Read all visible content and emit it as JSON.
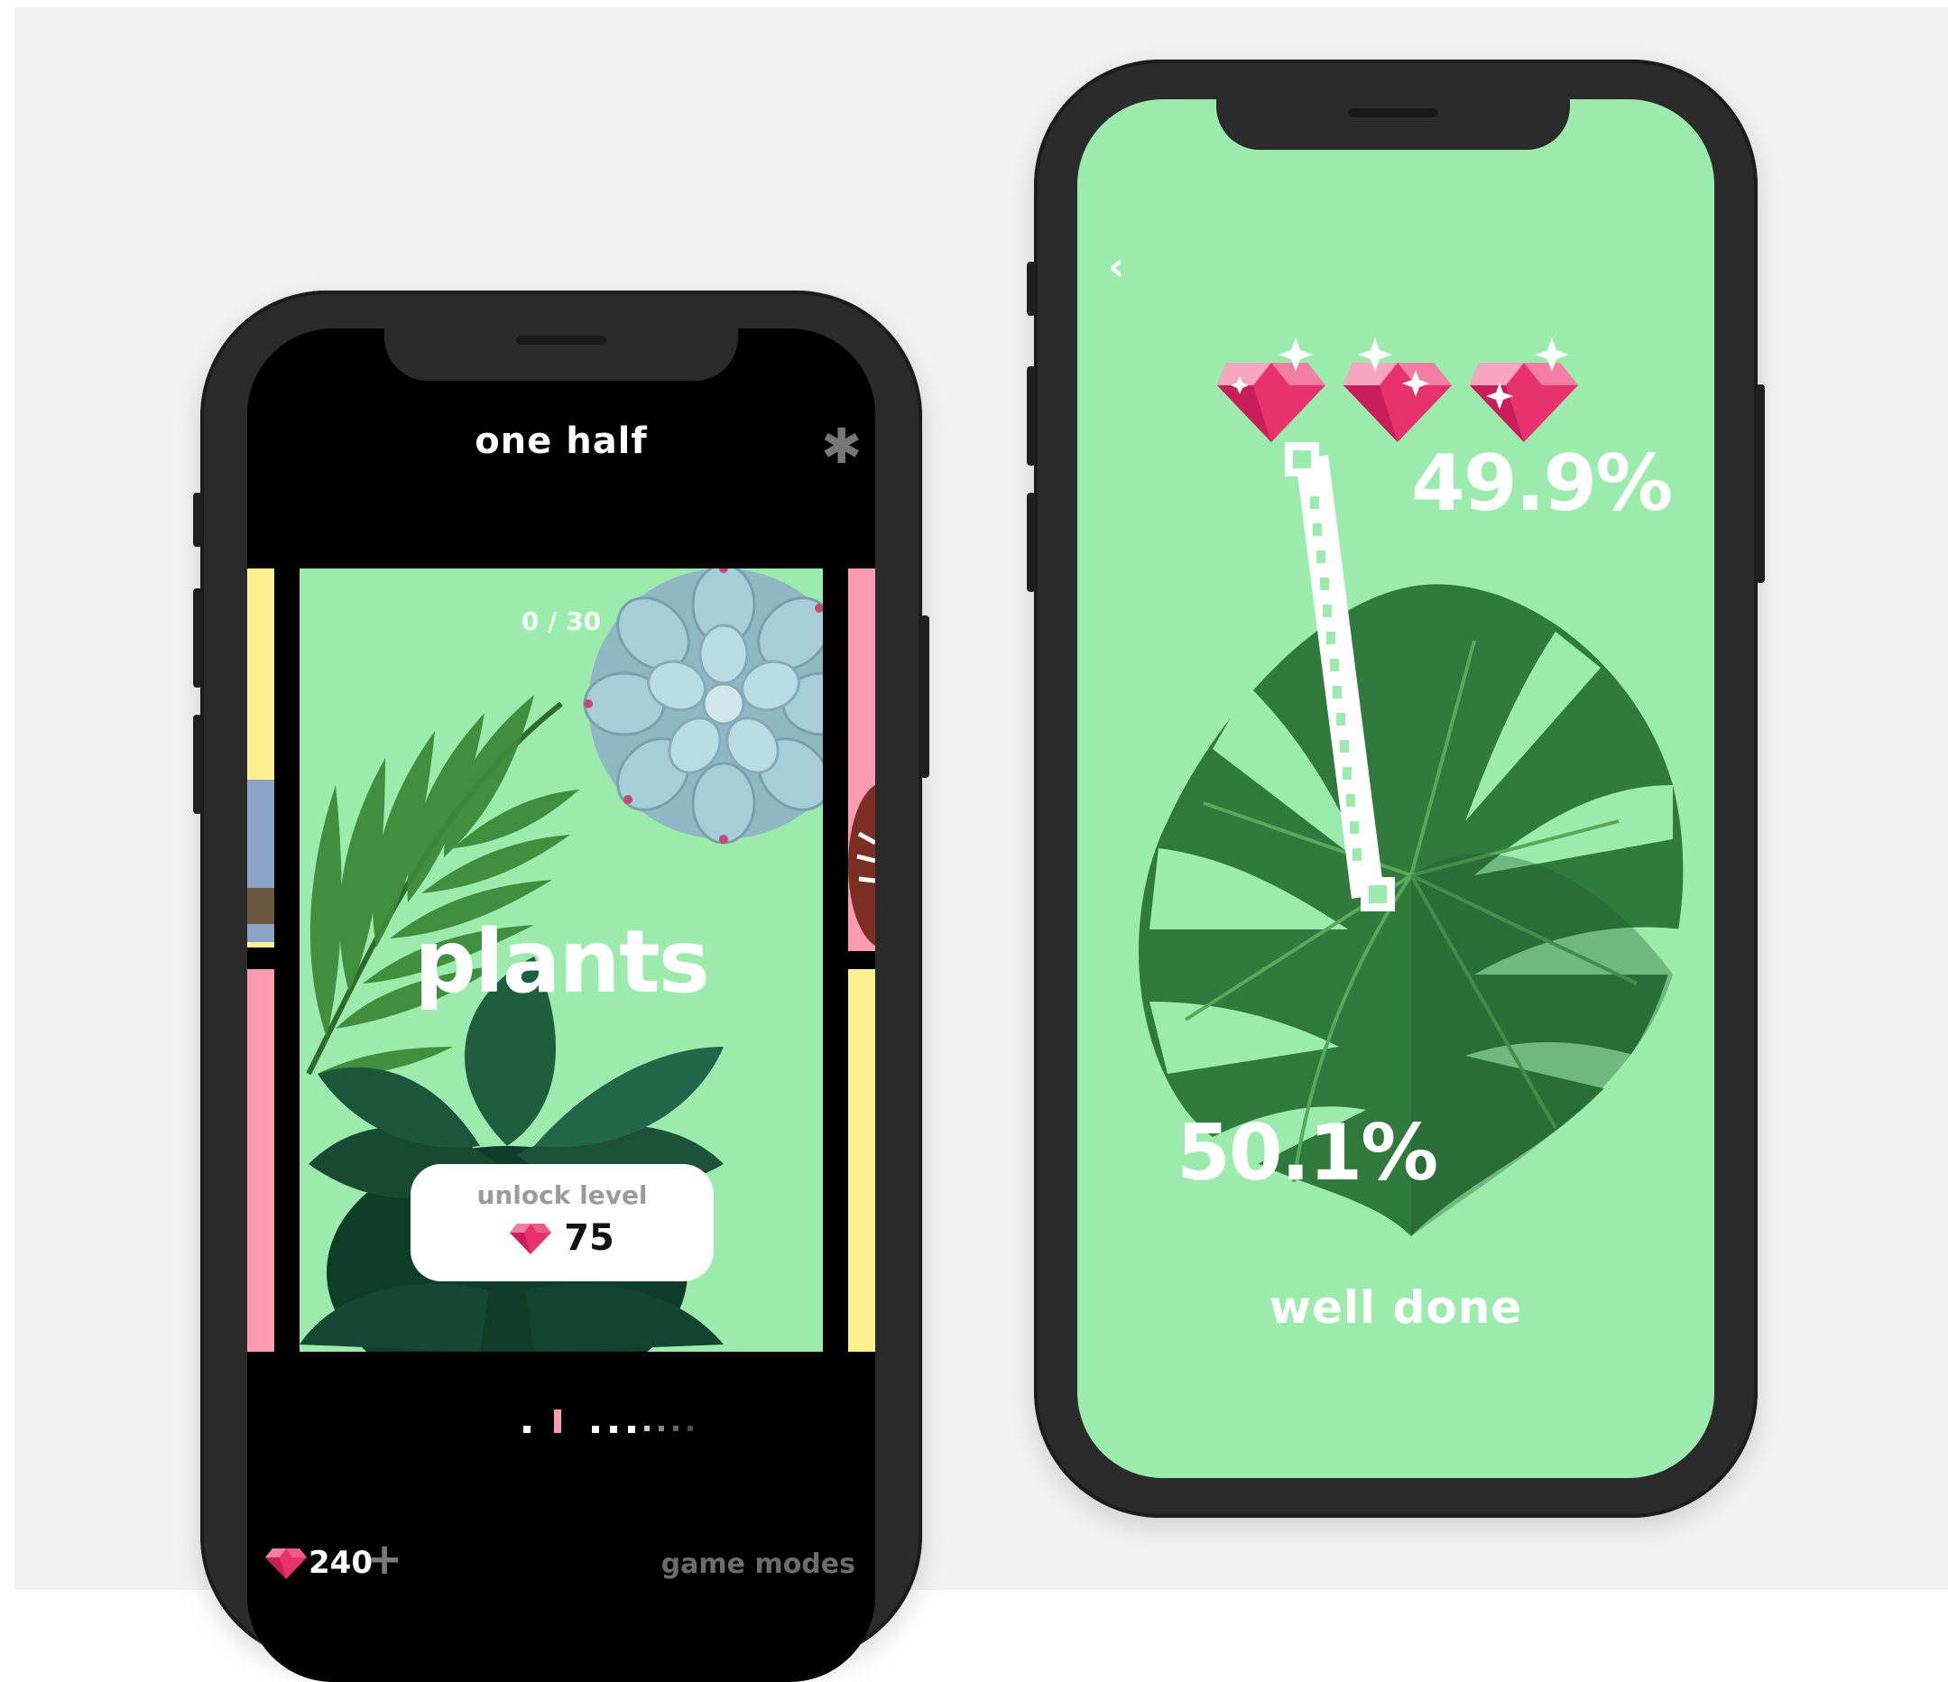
{
  "left_screen": {
    "title": "one half",
    "settings_icon": "asterisk-icon",
    "card": {
      "counter": "0 / 30",
      "title": "plants",
      "unlock_label": "unlock level",
      "unlock_cost": "75"
    },
    "pager": {
      "active_index": 1,
      "total": 9
    },
    "bottom": {
      "gems": "240",
      "modes_link": "game modes"
    }
  },
  "right_screen": {
    "back_icon": "chevron-left-icon",
    "stars_earned": 3,
    "percent_top": "49.9%",
    "percent_bottom": "50.1%",
    "message": "well done"
  },
  "colors": {
    "background": "#f2f2f2",
    "card_green": "#9bebad",
    "gem_pink": "#e8326e",
    "side_yellow": "#fff08f",
    "side_pink": "#ff9bb0"
  }
}
